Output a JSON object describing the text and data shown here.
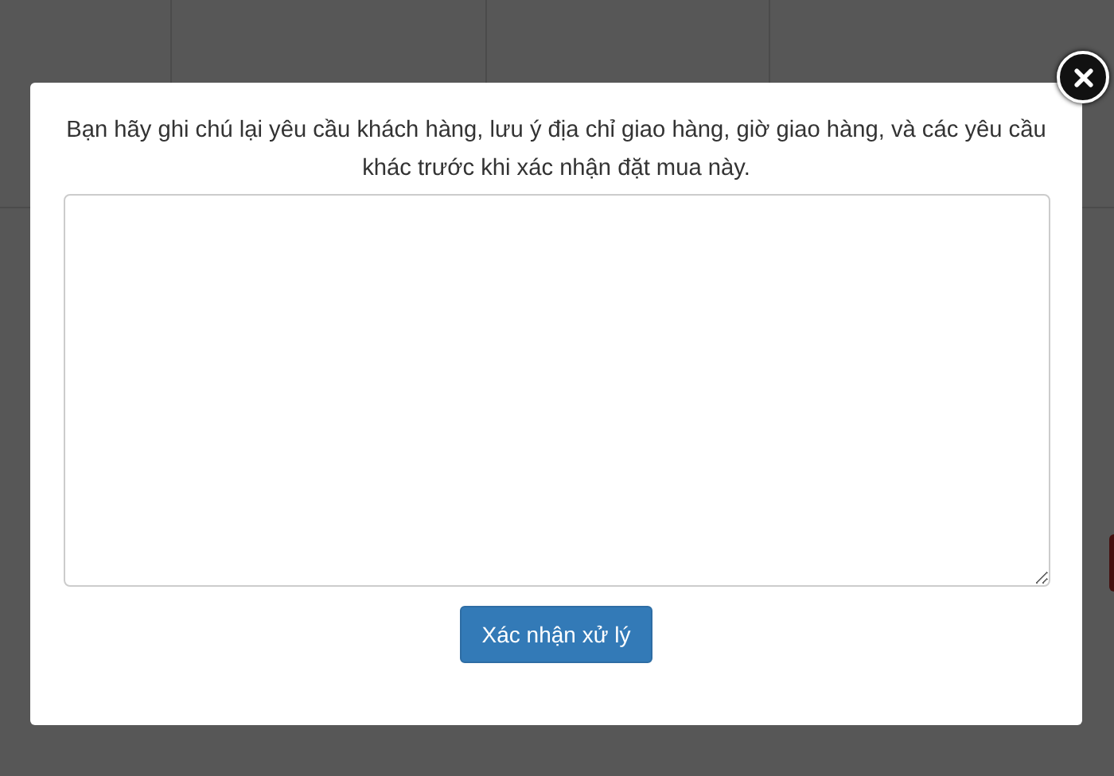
{
  "modal": {
    "message": "Bạn hãy ghi chú lại yêu cầu khách hàng, lưu ý địa chỉ giao hàng, giờ giao hàng, và các yêu cầu khác trước khi xác nhận đặt mua này.",
    "confirm_button": "Xác nhận xử lý"
  }
}
